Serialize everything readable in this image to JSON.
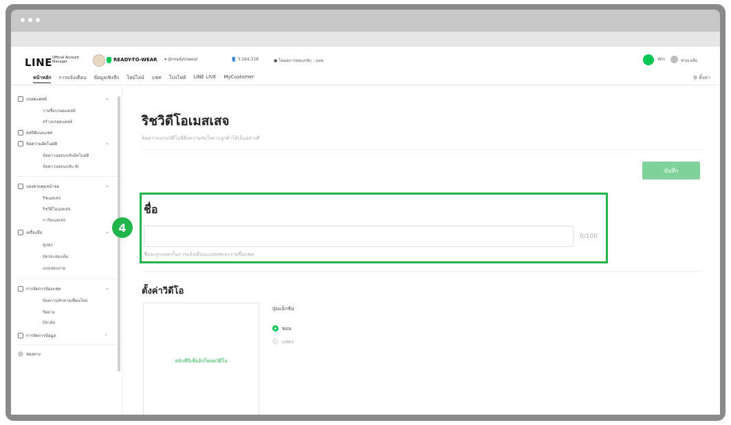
{
  "header": {
    "logo": "LINE",
    "logo_sub": "Official Account Manager",
    "account_name": "READY-TO-WEAR",
    "account_id": "▾ @readytowear",
    "followers": "👤 3,164,318",
    "mode": "● โหมดการตอบกลับ : บอท",
    "user": "Win",
    "help": "ช่วยเหลือ"
  },
  "nav": {
    "items": [
      "หน้าหลัก",
      "การแจ้งเตือน",
      "ข้อมูลเชิงลึก",
      "ไทม์ไลน์",
      "แชท",
      "โปรไฟล์",
      "LINE LIVE",
      "MyCustomer"
    ],
    "settings": "⚙ ตั้งค่า"
  },
  "sidebar": {
    "sections": [
      {
        "label": "บรอดแคสต์",
        "items": [
          "รายชื่อบรอดแคสต์",
          "สร้างบรอดแคสต์"
        ]
      },
      {
        "label": "ดสถิติแบบแชท",
        "items": []
      },
      {
        "label": "ข้อความอัตโนมัติ",
        "items": [
          "ข้อความตอบกลับอัตโนมัติ",
          "ข้อความตอบกลับ AI"
        ]
      },
      {
        "label": "แผงควบคุมหน้าจอ",
        "items": [
          "ริชเมสเสจ",
          "ริชวิดีโอเมสเสจ",
          "การ์ดเมสเสจ"
        ]
      },
      {
        "label": "เครื่องมือ",
        "items": [
          "คูปอง",
          "บัตรสะสมแต้ม",
          "แบบสอบถาม"
        ]
      },
      {
        "label": "การจัดการห้องแชท",
        "items": [
          "ข้อความทักทายเพื่อนใหม่",
          "รีพลาย",
          "On-Air"
        ]
      },
      {
        "label": "การจัดการข้อมูล",
        "items": []
      },
      {
        "label": "ช่องทาง",
        "items": []
      }
    ]
  },
  "main": {
    "title": "ริชวิดีโอเมสเสจ",
    "description": "ข้อความแบบวิดีโอที่ดึงความสนใจจากลูกค้าได้เป็นอย่างดี",
    "save_label": "บันทึก",
    "name_label": "ชื่อ",
    "name_value": "",
    "name_counter": "0/100",
    "name_help": "ชื่อจะถูกแสดงในการแจ้งเตือนแบบพุชและรายชื่อแชท",
    "step_badge": "4",
    "video_settings_title": "ตั้งค่าวิดีโอ",
    "upload_text": "คลิกที่นี่เพื่ออัปโหลดวิดีโอ",
    "action_button_label": "ปุ่มแอ็กชัน",
    "action_options": [
      {
        "label": "ซ่อน",
        "selected": true
      },
      {
        "label": "แสดง",
        "selected": false
      }
    ]
  },
  "colors": {
    "brand_green": "#06c755",
    "highlight": "#1fb54a",
    "save_button": "#7fd39a"
  }
}
